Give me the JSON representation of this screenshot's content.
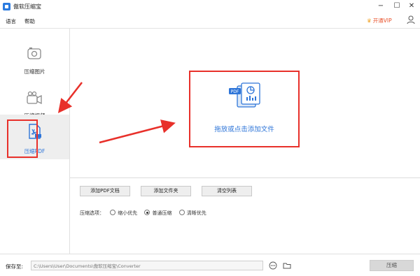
{
  "window": {
    "title": "傲软压缩宝",
    "minimize_glyph": "−",
    "maximize_glyph": "☐",
    "close_glyph": "✕"
  },
  "menu": {
    "items": [
      "语言",
      "帮助"
    ],
    "vip_label": "开通VIP"
  },
  "sidebar": {
    "items": [
      {
        "label": "压缩图片",
        "icon": "image-icon",
        "active": false
      },
      {
        "label": "压缩视频",
        "icon": "video-icon",
        "active": false
      },
      {
        "label": "压缩PDF",
        "icon": "pdf-icon",
        "active": true
      }
    ]
  },
  "main": {
    "drop_text": "拖放或点击添加文件",
    "buttons": [
      "添加PDF文档",
      "添加文件夹",
      "清空列表"
    ],
    "options_label": "压缩选项：",
    "options": [
      {
        "label": "缩小优先",
        "checked": false
      },
      {
        "label": "普通压缩",
        "checked": true
      },
      {
        "label": "清晰优先",
        "checked": false
      }
    ]
  },
  "bottom": {
    "save_label": "保存至:",
    "save_path": "C:\\Users\\User\\Documents\\傲软压缩宝\\Converter",
    "compress_label": "压缩"
  },
  "colors": {
    "accent_blue": "#2e75d8",
    "annotation_red": "#e8302a",
    "vip_orange": "#e8502a"
  }
}
